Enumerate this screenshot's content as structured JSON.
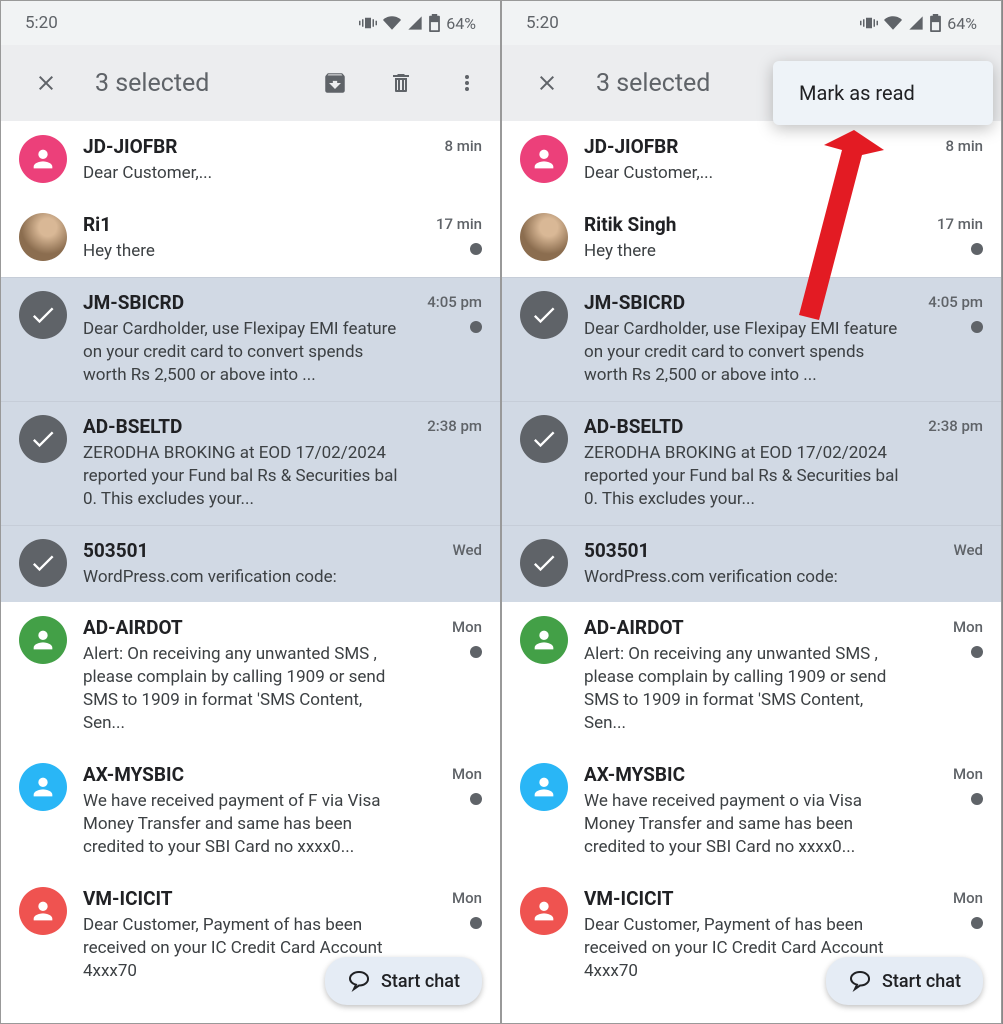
{
  "status_bar": {
    "time": "5:20",
    "battery": "64%"
  },
  "app_bar": {
    "title": "3 selected"
  },
  "popup": {
    "mark_as_read": "Mark as read"
  },
  "fab": {
    "label": "Start chat"
  },
  "messages_left": [
    {
      "sender": "JD-JIOFBR",
      "preview": "Dear Customer,...",
      "time": "8 min",
      "avatar": "pink",
      "selected": false,
      "unread": false
    },
    {
      "sender": "Ri1",
      "preview": "Hey there",
      "time": "17 min",
      "avatar": "photo",
      "selected": false,
      "unread": true
    },
    {
      "sender": "JM-SBICRD",
      "preview": "Dear Cardholder, use Flexipay EMI feature on your credit card to convert spends worth Rs 2,500 or above into ...",
      "time": "4:05 pm",
      "avatar": "check",
      "selected": true,
      "unread": true
    },
    {
      "sender": "AD-BSELTD",
      "preview": "ZERODHA BROKING at EOD 17/02/2024 reported your Fund bal Rs\n& Securities bal 0. This excludes your...",
      "time": "2:38 pm",
      "avatar": "check",
      "selected": true,
      "unread": false
    },
    {
      "sender": "503501",
      "preview": "WordPress.com verification code:",
      "time": "Wed",
      "avatar": "check",
      "selected": true,
      "unread": false
    },
    {
      "sender": "AD-AIRDOT",
      "preview": "Alert: On receiving any unwanted SMS , please complain by calling 1909 or send SMS to 1909 in format 'SMS Content, Sen...",
      "time": "Mon",
      "avatar": "green",
      "selected": false,
      "unread": true
    },
    {
      "sender": "AX-MYSBIC",
      "preview": "We have received payment of F\nvia Visa Money Transfer and same has been credited to your SBI Card no xxxx0...",
      "time": "Mon",
      "avatar": "cyan",
      "selected": false,
      "unread": true
    },
    {
      "sender": "VM-ICICIT",
      "preview": "Dear Customer, Payment of\nhas been received on your IC\nCredit Card Account 4xxx70",
      "time": "Mon",
      "avatar": "red",
      "selected": false,
      "unread": true
    }
  ],
  "messages_right": [
    {
      "sender": "JD-JIOFBR",
      "preview": "Dear Customer,...",
      "time": "8 min",
      "avatar": "pink",
      "selected": false,
      "unread": false
    },
    {
      "sender": "Ritik Singh",
      "preview": "Hey there",
      "time": "17 min",
      "avatar": "photo",
      "selected": false,
      "unread": true
    },
    {
      "sender": "JM-SBICRD",
      "preview": "Dear Cardholder, use Flexipay EMI feature on your credit card to convert spends worth Rs 2,500 or above into ...",
      "time": "4:05 pm",
      "avatar": "check",
      "selected": true,
      "unread": true
    },
    {
      "sender": "AD-BSELTD",
      "preview": "ZERODHA BROKING at EOD 17/02/2024 reported your Fund bal Rs\n& Securities bal 0. This excludes your...",
      "time": "2:38 pm",
      "avatar": "check",
      "selected": true,
      "unread": false
    },
    {
      "sender": "503501",
      "preview": "WordPress.com verification code:",
      "time": "Wed",
      "avatar": "check",
      "selected": true,
      "unread": false
    },
    {
      "sender": "AD-AIRDOT",
      "preview": "Alert: On receiving any unwanted SMS , please complain by calling 1909 or send SMS to 1909 in format 'SMS Content, Sen...",
      "time": "Mon",
      "avatar": "green",
      "selected": false,
      "unread": true
    },
    {
      "sender": "AX-MYSBIC",
      "preview": "We have received payment o\nvia Visa Money Transfer and same has been credited to your SBI Card no xxxx0...",
      "time": "Mon",
      "avatar": "cyan",
      "selected": false,
      "unread": true
    },
    {
      "sender": "VM-ICICIT",
      "preview": "Dear Customer, Payment of\nhas been received on your IC\nCredit Card Account 4xxx70",
      "time": "Mon",
      "avatar": "red",
      "selected": false,
      "unread": true
    }
  ]
}
